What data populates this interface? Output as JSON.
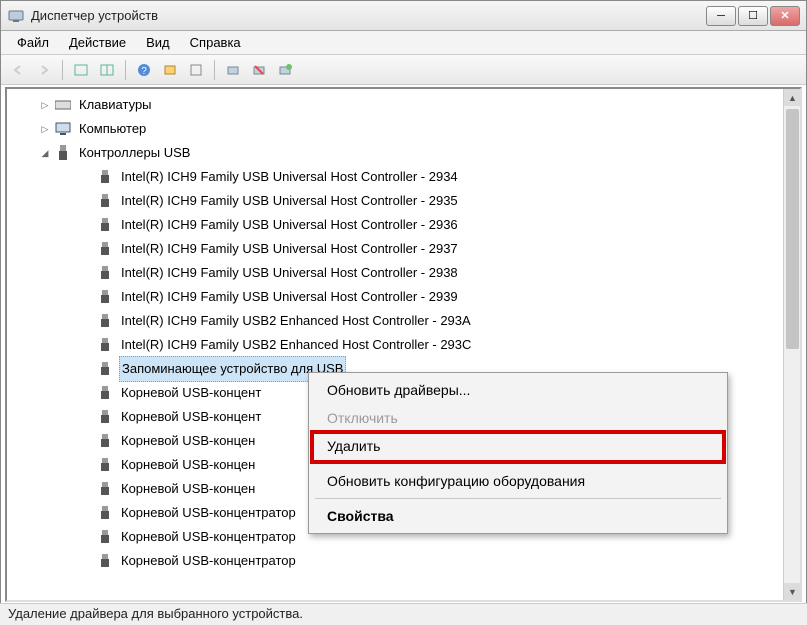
{
  "window": {
    "title": "Диспетчер устройств"
  },
  "menubar": {
    "file": "Файл",
    "action": "Действие",
    "view": "Вид",
    "help": "Справка"
  },
  "tree": {
    "keyboards": "Клавиатуры",
    "computer": "Компьютер",
    "usb_controllers": "Контроллеры USB",
    "items": [
      "Intel(R) ICH9 Family USB Universal Host Controller - 2934",
      "Intel(R) ICH9 Family USB Universal Host Controller - 2935",
      "Intel(R) ICH9 Family USB Universal Host Controller - 2936",
      "Intel(R) ICH9 Family USB Universal Host Controller - 2937",
      "Intel(R) ICH9 Family USB Universal Host Controller - 2938",
      "Intel(R) ICH9 Family USB Universal Host Controller - 2939",
      "Intel(R) ICH9 Family USB2 Enhanced Host Controller - 293A",
      "Intel(R) ICH9 Family USB2 Enhanced Host Controller - 293C"
    ],
    "storage_device": "Запоминающее устройство для USB",
    "hub_full": "Корневой USB-концентратор",
    "hub_cut": "Корневой USB-концент",
    "hub_cut2": "Корневой USB-концен"
  },
  "context_menu": {
    "update": "Обновить драйверы...",
    "disable": "Отключить",
    "delete": "Удалить",
    "scan": "Обновить конфигурацию оборудования",
    "properties": "Свойства"
  },
  "statusbar": {
    "text": "Удаление драйвера для выбранного устройства."
  }
}
